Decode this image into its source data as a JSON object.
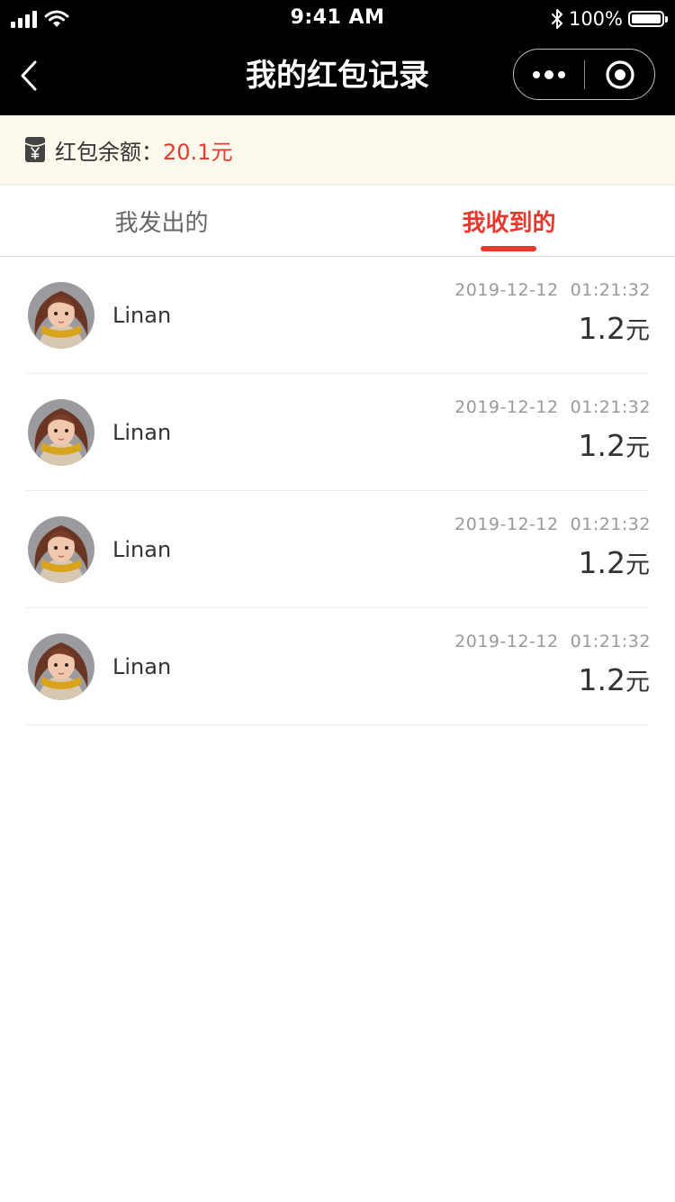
{
  "status_bar": {
    "time": "9:41 AM",
    "battery": "100%"
  },
  "nav": {
    "title": "我的红包记录"
  },
  "balance": {
    "label": "红包余额：",
    "value": "20.1元"
  },
  "tabs": [
    {
      "label": "我发出的",
      "active": false
    },
    {
      "label": "我收到的",
      "active": true
    }
  ],
  "records": [
    {
      "name": "Linan",
      "time": "2019-12-12  01:21:32",
      "amount": "1.2",
      "unit": "元"
    },
    {
      "name": "Linan",
      "time": "2019-12-12  01:21:32",
      "amount": "1.2",
      "unit": "元"
    },
    {
      "name": "Linan",
      "time": "2019-12-12  01:21:32",
      "amount": "1.2",
      "unit": "元"
    },
    {
      "name": "Linan",
      "time": "2019-12-12  01:21:32",
      "amount": "1.2",
      "unit": "元"
    }
  ],
  "colors": {
    "accent": "#e8392f",
    "nav_background": "#000000",
    "balance_background": "#fdf9ec"
  },
  "icons": {
    "back": "back-arrow-icon",
    "more": "more-dots-icon",
    "close": "target-circle-icon",
    "wallet": "red-packet-icon"
  }
}
